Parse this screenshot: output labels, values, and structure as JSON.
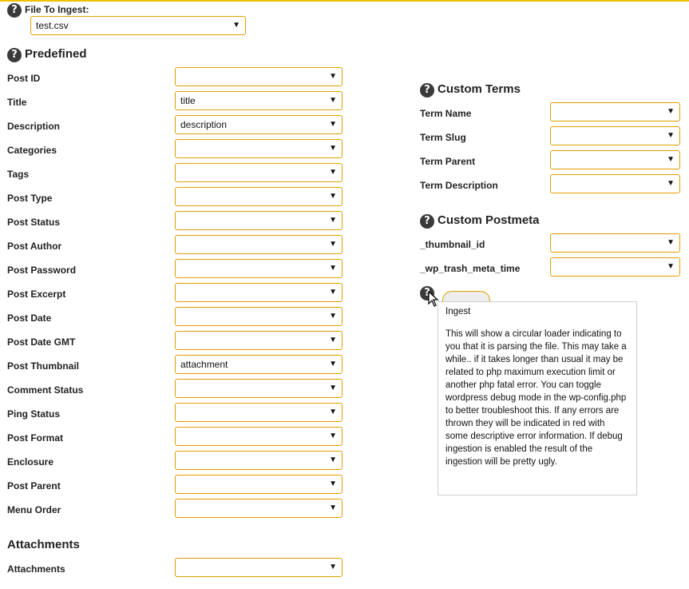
{
  "file_ingest": {
    "label": "File To Ingest:",
    "value": "test.csv"
  },
  "sections": {
    "predefined": "Predefined",
    "custom_terms": "Custom Terms",
    "custom_postmeta": "Custom Postmeta",
    "attachments": "Attachments"
  },
  "predefined_fields": [
    {
      "label": "Post ID",
      "value": ""
    },
    {
      "label": "Title",
      "value": "title"
    },
    {
      "label": "Description",
      "value": "description"
    },
    {
      "label": "Categories",
      "value": ""
    },
    {
      "label": "Tags",
      "value": ""
    },
    {
      "label": "Post Type",
      "value": ""
    },
    {
      "label": "Post Status",
      "value": ""
    },
    {
      "label": "Post Author",
      "value": ""
    },
    {
      "label": "Post Password",
      "value": ""
    },
    {
      "label": "Post Excerpt",
      "value": ""
    },
    {
      "label": "Post Date",
      "value": ""
    },
    {
      "label": "Post Date GMT",
      "value": ""
    },
    {
      "label": "Post Thumbnail",
      "value": "attachment"
    },
    {
      "label": "Comment Status",
      "value": ""
    },
    {
      "label": "Ping Status",
      "value": ""
    },
    {
      "label": "Post Format",
      "value": ""
    },
    {
      "label": "Enclosure",
      "value": ""
    },
    {
      "label": "Post Parent",
      "value": ""
    },
    {
      "label": "Menu Order",
      "value": ""
    }
  ],
  "term_fields": [
    {
      "label": "Term Name",
      "value": ""
    },
    {
      "label": "Term Slug",
      "value": ""
    },
    {
      "label": "Term Parent",
      "value": ""
    },
    {
      "label": "Term Description",
      "value": ""
    }
  ],
  "postmeta_fields": [
    {
      "label": "_thumbnail_id",
      "value": ""
    },
    {
      "label": "_wp_trash_meta_time",
      "value": ""
    }
  ],
  "attachment_fields": [
    {
      "label": "Attachments",
      "value": ""
    }
  ],
  "help_glyph": "?",
  "dropdown_arrow": "▼",
  "tooltip": {
    "title": "Ingest",
    "body": "This will show a circular loader indicating to you that it is parsing the file. This may take a while.. if it takes longer than usual it may be related to php maximum execution limit or another php fatal error. You can toggle wordpress debug mode in the wp-config.php to better troubleshoot this. If any errors are thrown they will be indicated in red with some descriptive error information. If debug ingestion is enabled the result of the ingestion will be pretty ugly."
  }
}
